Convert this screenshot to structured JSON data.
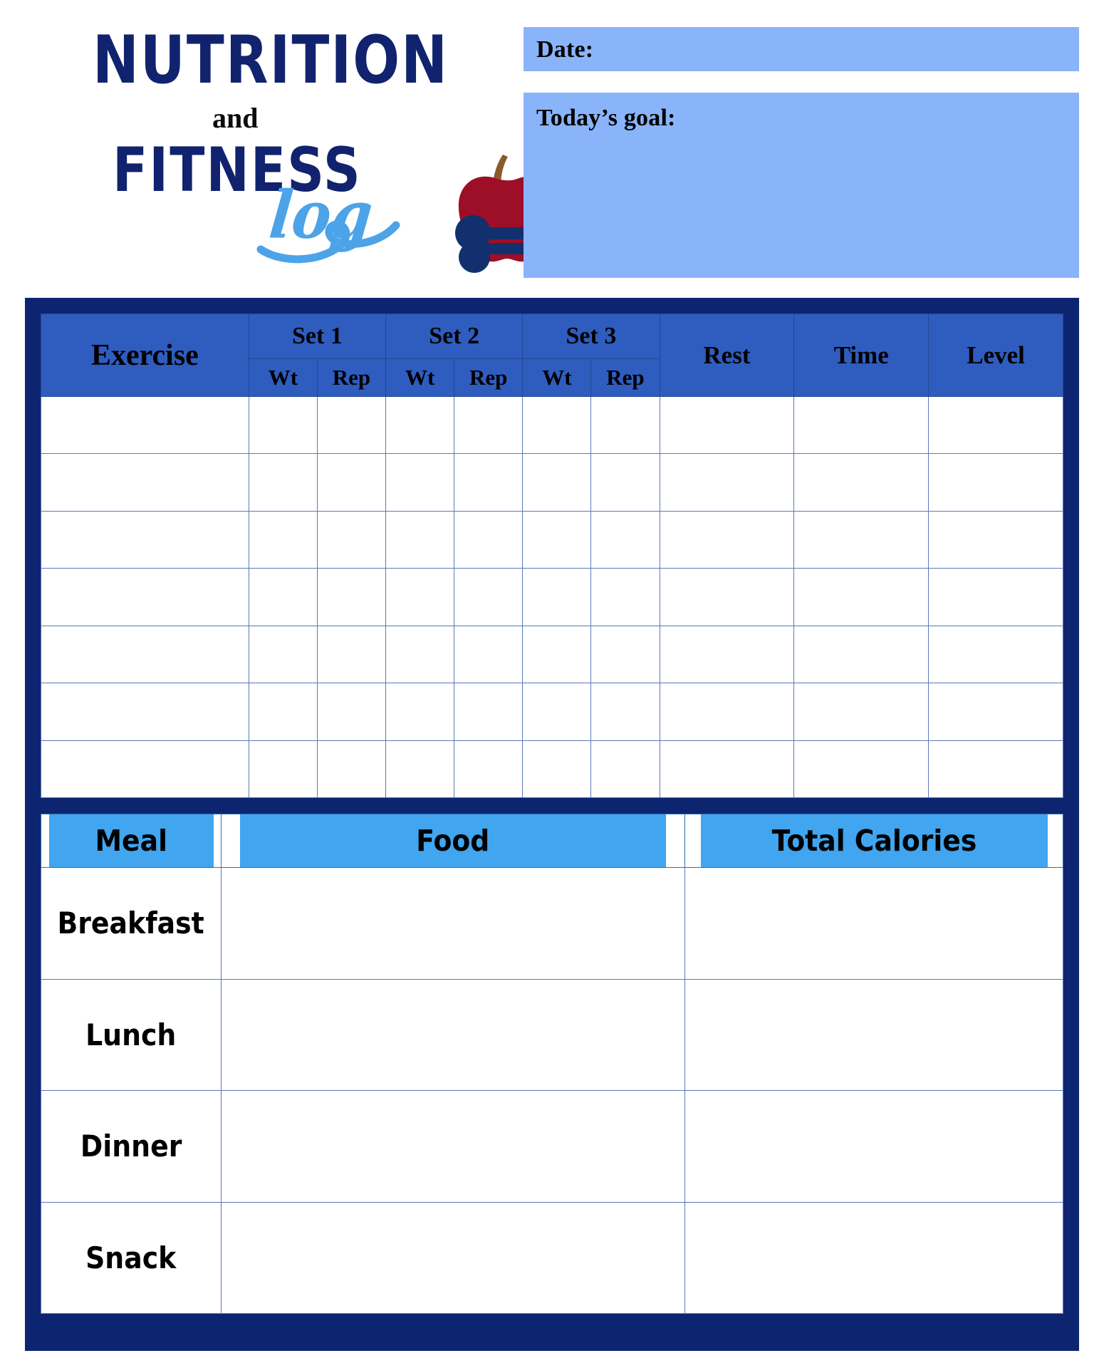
{
  "logo": {
    "line1": "NUTRITION",
    "line2": "and",
    "line3": "FITNESS",
    "line4": "log",
    "colors": {
      "title_navy": "#11236e",
      "script_blue": "#4da3e8",
      "apple_red": "#9c0f26",
      "stem_brown": "#8a5a2b",
      "dumbbell_navy": "#12306e"
    }
  },
  "header_fields": {
    "date_label": "Date:",
    "date_value": "",
    "goal_label": "Today’s goal:",
    "goal_value": "",
    "box_color": "#8ab4fa"
  },
  "exercise_table": {
    "columns": {
      "exercise": "Exercise",
      "set1": "Set 1",
      "set2": "Set 2",
      "set3": "Set 3",
      "rest": "Rest",
      "time": "Time",
      "level": "Level"
    },
    "sub_columns": {
      "weight": "Wt",
      "reps": "Rep"
    },
    "row_count": 7,
    "rows": [
      {
        "exercise": "",
        "set1_wt": "",
        "set1_rep": "",
        "set2_wt": "",
        "set2_rep": "",
        "set3_wt": "",
        "set3_rep": "",
        "rest": "",
        "time": "",
        "level": ""
      },
      {
        "exercise": "",
        "set1_wt": "",
        "set1_rep": "",
        "set2_wt": "",
        "set2_rep": "",
        "set3_wt": "",
        "set3_rep": "",
        "rest": "",
        "time": "",
        "level": ""
      },
      {
        "exercise": "",
        "set1_wt": "",
        "set1_rep": "",
        "set2_wt": "",
        "set2_rep": "",
        "set3_wt": "",
        "set3_rep": "",
        "rest": "",
        "time": "",
        "level": ""
      },
      {
        "exercise": "",
        "set1_wt": "",
        "set1_rep": "",
        "set2_wt": "",
        "set2_rep": "",
        "set3_wt": "",
        "set3_rep": "",
        "rest": "",
        "time": "",
        "level": ""
      },
      {
        "exercise": "",
        "set1_wt": "",
        "set1_rep": "",
        "set2_wt": "",
        "set2_rep": "",
        "set3_wt": "",
        "set3_rep": "",
        "rest": "",
        "time": "",
        "level": ""
      },
      {
        "exercise": "",
        "set1_wt": "",
        "set1_rep": "",
        "set2_wt": "",
        "set2_rep": "",
        "set3_wt": "",
        "set3_rep": "",
        "rest": "",
        "time": "",
        "level": ""
      },
      {
        "exercise": "",
        "set1_wt": "",
        "set1_rep": "",
        "set2_wt": "",
        "set2_rep": "",
        "set3_wt": "",
        "set3_rep": "",
        "rest": "",
        "time": "",
        "level": ""
      }
    ],
    "header_color": "#2f5cbf",
    "frame_color": "#0d2470"
  },
  "meal_table": {
    "columns": {
      "meal": "Meal",
      "food": "Food",
      "calories": "Total Calories"
    },
    "rows": [
      {
        "meal": "Breakfast",
        "food": "",
        "calories": ""
      },
      {
        "meal": "Lunch",
        "food": "",
        "calories": ""
      },
      {
        "meal": "Dinner",
        "food": "",
        "calories": ""
      },
      {
        "meal": "Snack",
        "food": "",
        "calories": ""
      }
    ],
    "header_color": "#41a5ef"
  }
}
